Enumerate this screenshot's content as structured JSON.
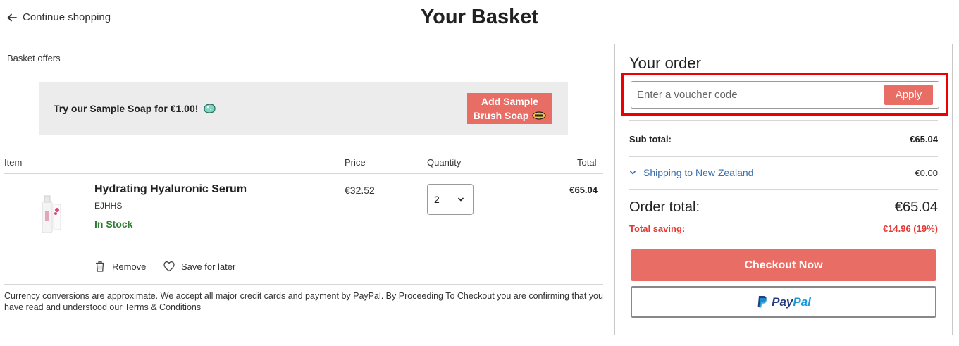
{
  "header": {
    "continue_label": "Continue shopping",
    "title": "Your Basket"
  },
  "offers": {
    "section_label": "Basket offers",
    "offer_text": "Try our Sample Soap for €1.00!",
    "add_button_line1": "Add Sample",
    "add_button_line2": "Brush Soap"
  },
  "table": {
    "headers": {
      "item": "Item",
      "price": "Price",
      "quantity": "Quantity",
      "total": "Total"
    },
    "items": [
      {
        "name": "Hydrating Hyaluronic Serum",
        "code": "EJHHS",
        "stock": "In Stock",
        "price": "€32.52",
        "quantity": "2",
        "total": "€65.04",
        "remove_label": "Remove",
        "save_label": "Save for later"
      }
    ]
  },
  "disclaimer": "Currency conversions are approximate. We accept all major credit cards and payment by PayPal. By Proceeding To Checkout you are confirming that you have read and understood our Terms & Conditions",
  "order": {
    "title": "Your order",
    "voucher_placeholder": "Enter a voucher code",
    "apply_label": "Apply",
    "subtotal_label": "Sub total:",
    "subtotal_value": "€65.04",
    "shipping_label": "Shipping to New Zealand",
    "shipping_value": "€0.00",
    "total_label": "Order total:",
    "total_value": "€65.04",
    "saving_label": "Total saving:",
    "saving_value": "€14.96 (19%)",
    "checkout_label": "Checkout Now",
    "paypal_pay": "Pay",
    "paypal_pal": "Pal"
  },
  "colors": {
    "accent": "#e86d65",
    "stock_green": "#2e7d32",
    "saving_red": "#e53935",
    "link_blue": "#3a6fb0",
    "highlight_red": "#ee0000"
  },
  "icons": [
    "arrow-left-icon",
    "soap-icon",
    "brush-icon",
    "chevron-down-icon",
    "trash-icon",
    "heart-icon",
    "paypal-icon"
  ]
}
